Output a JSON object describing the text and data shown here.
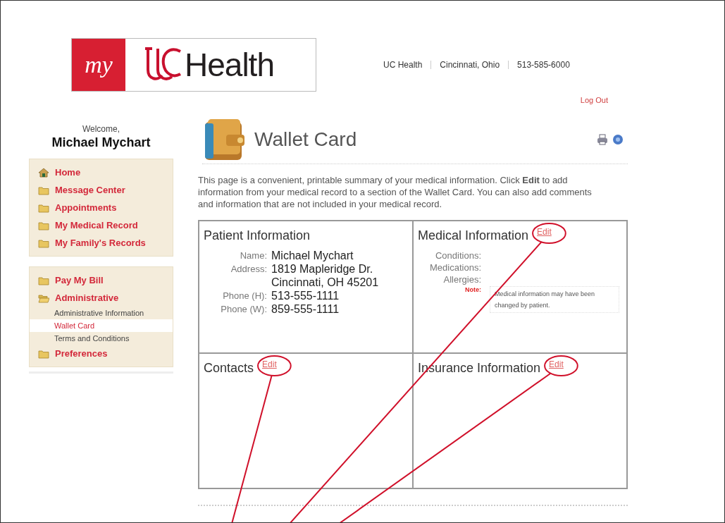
{
  "logo": {
    "prefix": "my",
    "name": "Health"
  },
  "header_links": [
    "UC Health",
    "Cincinnati, Ohio",
    "513-585-6000"
  ],
  "logout": "Log Out",
  "welcome": {
    "greeting": "Welcome,",
    "name": "Michael Mychart"
  },
  "nav_groups": [
    {
      "items": [
        {
          "label": "Home",
          "kind": "home"
        },
        {
          "label": "Message Center",
          "kind": "folder"
        },
        {
          "label": "Appointments",
          "kind": "folder"
        },
        {
          "label": "My Medical Record",
          "kind": "folder"
        },
        {
          "label": "My Family's Records",
          "kind": "folder"
        }
      ]
    },
    {
      "items": [
        {
          "label": "Pay My Bill",
          "kind": "folder"
        },
        {
          "label": "Administrative",
          "kind": "open-folder",
          "children": [
            {
              "label": "Administrative Information",
              "selected": false
            },
            {
              "label": "Wallet Card",
              "selected": true
            },
            {
              "label": "Terms and Conditions",
              "selected": false
            }
          ]
        },
        {
          "label": "Preferences",
          "kind": "folder"
        }
      ]
    }
  ],
  "page": {
    "title": "Wallet Card",
    "intro": "This page is a convenient, printable summary of your medical information. Click **Edit** to add information from your medical record to a section of the Wallet Card. You can also add comments and information that are not included in your medical record."
  },
  "sections": [
    {
      "title": "Patient Information",
      "fields": [
        {
          "label": "Name:",
          "lines": [
            "Michael Mychart"
          ]
        },
        {
          "label": "Address:",
          "lines": [
            "1819 Mapleridge Dr.",
            "Cincinnati, OH 45201"
          ]
        },
        {
          "label": "Phone (H):",
          "lines": [
            "513-555-1111"
          ]
        },
        {
          "label": "Phone (W):",
          "lines": [
            "859-555-1111"
          ]
        }
      ]
    },
    {
      "title": "Medical Information",
      "edit": {
        "label": "Edit",
        "circled": true
      },
      "fields": [
        {
          "label": "Conditions:"
        },
        {
          "label": "Medications:"
        },
        {
          "label": "Allergies:"
        }
      ],
      "note": {
        "label": "Note:",
        "text": "Medical information may have been changed by patient."
      }
    },
    {
      "title": "Contacts",
      "edit": {
        "label": "Edit",
        "circled": true
      }
    },
    {
      "title": "Insurance Information",
      "edit": {
        "label": "Edit",
        "circled": true
      }
    }
  ]
}
